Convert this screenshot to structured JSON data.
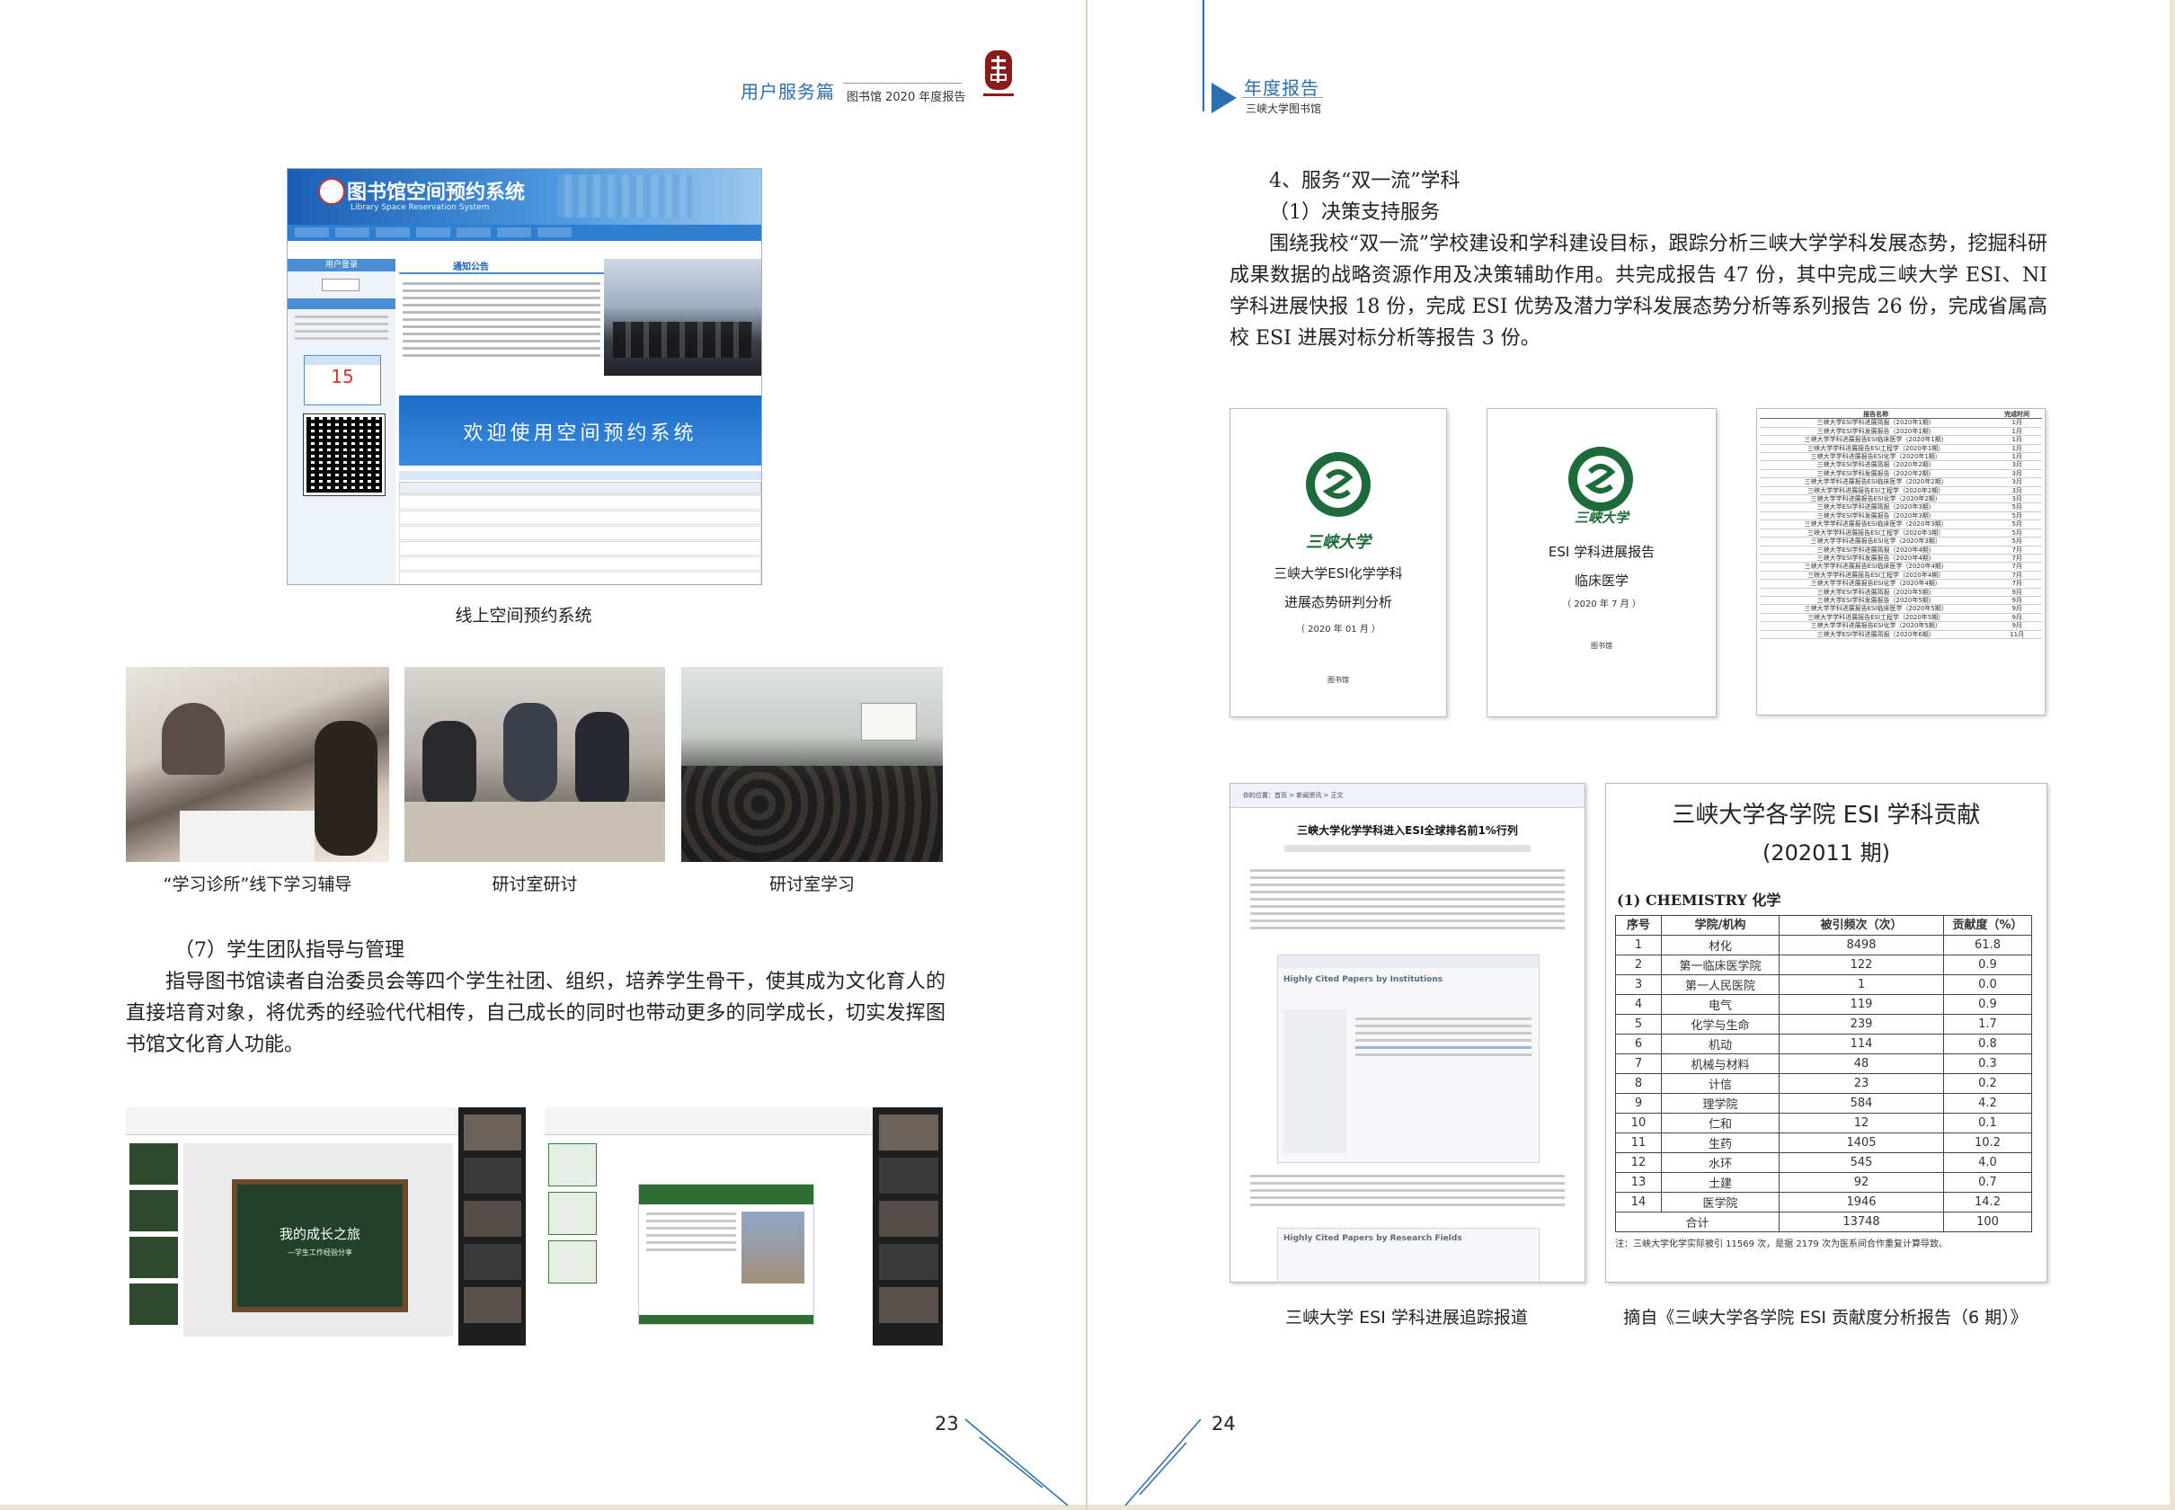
{
  "left_page": {
    "header": {
      "section": "用户服务篇",
      "subtitle": "图书馆 2020 年度报告"
    },
    "figure1": {
      "caption": "线上空间预约系统",
      "banner_title": "图书馆空间预约系统",
      "banner_subtitle": "Library Space Reservation System",
      "welcome_text": "欢迎使用空间预约系统",
      "notice_title": "通知公告",
      "login_label": "用户登录",
      "calendar_day": "15"
    },
    "photos": [
      {
        "caption": "“学习诊所”线下学习辅导"
      },
      {
        "caption": "研讨室研讨"
      },
      {
        "caption": "研讨室学习"
      }
    ],
    "section7": {
      "heading": "（7）学生团队指导与管理",
      "paragraph": "指导图书馆读者自治委员会等四个学生社团、组织，培养学生骨干，使其成为文化育人的直接培育对象，将优秀的经验代代相传，自己成长的同时也带动更多的同学成长，切实发挥图书馆文化育人功能。"
    },
    "screenshots": {
      "slide_title": "我的成长之旅",
      "slide_subtitle": "—学生工作经验分享"
    },
    "page_number": "23"
  },
  "right_page": {
    "header": {
      "title": "年度报告",
      "subtitle": "三峡大学图书馆"
    },
    "section4": {
      "heading": "4、服务“双一流”学科",
      "subheading": "（1）决策支持服务",
      "paragraph": "围绕我校“双一流”学校建设和学科建设目标，跟踪分析三峡大学学科发展态势，挖掘科研成果数据的战略资源作用及决策辅助作用。共完成报告 47 份，其中完成三峡大学 ESI、NI 学科进展快报 18 份，完成 ESI 优势及潜力学科发展态势分析等系列报告 26 份，完成省属高校 ESI 进展对标分析等报告 3 份。"
    },
    "report_cover1": {
      "school": "三峡大学",
      "title_line1": "三峡大学ESI化学学科",
      "title_line2": "进展态势研判分析",
      "date": "（ 2020 年 01 月 ）",
      "org": "图书馆"
    },
    "report_cover2": {
      "school": "三峡大学",
      "title_line1": "ESI 学科进展报告",
      "title_line2": "临床医学",
      "date": "（ 2020 年 7 月 ）",
      "org": "图书馆"
    },
    "report_list": {
      "col1": "报告名称",
      "col2": "完成时间",
      "rows": [
        [
          "三峡大学ESI学科进展简报（2020年1期）",
          "1月"
        ],
        [
          "三峡大学ESI学科发展报告（2020年1期）",
          "1月"
        ],
        [
          "三峡大学学科进展报告ESI临床医学（2020年1期）",
          "1月"
        ],
        [
          "三峡大学学科进展报告ESI工程学（2020年1期）",
          "1月"
        ],
        [
          "三峡大学学科进展报告ESI化学（2020年1期）",
          "1月"
        ],
        [
          "三峡大学ESI学科进展简报（2020年2期）",
          "3月"
        ],
        [
          "三峡大学ESI学科发展报告（2020年2期）",
          "3月"
        ],
        [
          "三峡大学学科进展报告ESI临床医学（2020年2期）",
          "3月"
        ],
        [
          "三峡大学学科进展报告ESI工程学（2020年2期）",
          "3月"
        ],
        [
          "三峡大学学科进展报告ESI化学（2020年2期）",
          "3月"
        ],
        [
          "三峡大学ESI学科进展简报（2020年3期）",
          "5月"
        ],
        [
          "三峡大学ESI学科发展报告（2020年3期）",
          "5月"
        ],
        [
          "三峡大学学科进展报告ESI临床医学（2020年3期）",
          "5月"
        ],
        [
          "三峡大学学科进展报告ESI工程学（2020年3期）",
          "5月"
        ],
        [
          "三峡大学学科进展报告ESI化学（2020年3期）",
          "5月"
        ],
        [
          "三峡大学ESI学科进展简报（2020年4期）",
          "7月"
        ],
        [
          "三峡大学ESI学科发展报告（2020年4期）",
          "7月"
        ],
        [
          "三峡大学学科进展报告ESI临床医学（2020年4期）",
          "7月"
        ],
        [
          "三峡大学学科进展报告ESI工程学（2020年4期）",
          "7月"
        ],
        [
          "三峡大学学科进展报告ESI化学（2020年4期）",
          "7月"
        ],
        [
          "三峡大学ESI学科进展简报（2020年5期）",
          "9月"
        ],
        [
          "三峡大学ESI学科发展报告（2020年5期）",
          "9月"
        ],
        [
          "三峡大学学科进展报告ESI临床医学（2020年5期）",
          "9月"
        ],
        [
          "三峡大学学科进展报告ESI工程学（2020年5期）",
          "9月"
        ],
        [
          "三峡大学学科进展报告ESI化学（2020年5期）",
          "9月"
        ],
        [
          "三峡大学ESI学科进展简报（2020年6期）",
          "11月"
        ]
      ]
    },
    "news_article": {
      "breadcrumb": "你的位置：首页 > 新闻资讯 > 正文",
      "headline": "三峡大学化学学科进入ESI全球排名前1%行列",
      "hcp_title": "Highly Cited Papers by Institutions",
      "hcp_title2": "Highly Cited Papers by Research Fields",
      "caption": "三峡大学 ESI 学科进展追踪报道"
    },
    "esi_table": {
      "title": "三峡大学各学院 ESI 学科贡献",
      "period": "(202011 期)",
      "subject": "(1) CHEMISTRY 化学",
      "headers": [
        "序号",
        "学院/机构",
        "被引频次（次）",
        "贡献度（%）"
      ],
      "rows": [
        [
          "1",
          "材化",
          "8498",
          "61.8"
        ],
        [
          "2",
          "第一临床医学院",
          "122",
          "0.9"
        ],
        [
          "3",
          "第一人民医院",
          "1",
          "0.0"
        ],
        [
          "4",
          "电气",
          "119",
          "0.9"
        ],
        [
          "5",
          "化学与生命",
          "239",
          "1.7"
        ],
        [
          "6",
          "机动",
          "114",
          "0.8"
        ],
        [
          "7",
          "机械与材料",
          "48",
          "0.3"
        ],
        [
          "8",
          "计信",
          "23",
          "0.2"
        ],
        [
          "9",
          "理学院",
          "584",
          "4.2"
        ],
        [
          "10",
          "仁和",
          "12",
          "0.1"
        ],
        [
          "11",
          "生药",
          "1405",
          "10.2"
        ],
        [
          "12",
          "水环",
          "545",
          "4.0"
        ],
        [
          "13",
          "土建",
          "92",
          "0.7"
        ],
        [
          "14",
          "医学院",
          "1946",
          "14.2"
        ]
      ],
      "total_label": "合计",
      "total_value": "13748",
      "total_pct": "100",
      "note": "注：三峡大学化学实际被引 11569 次，是据 2179 次为医系间合作重复计算导致。",
      "caption": "摘自《三峡大学各学院 ESI 贡献度分析报告（6 期）》"
    },
    "page_number": "24"
  }
}
